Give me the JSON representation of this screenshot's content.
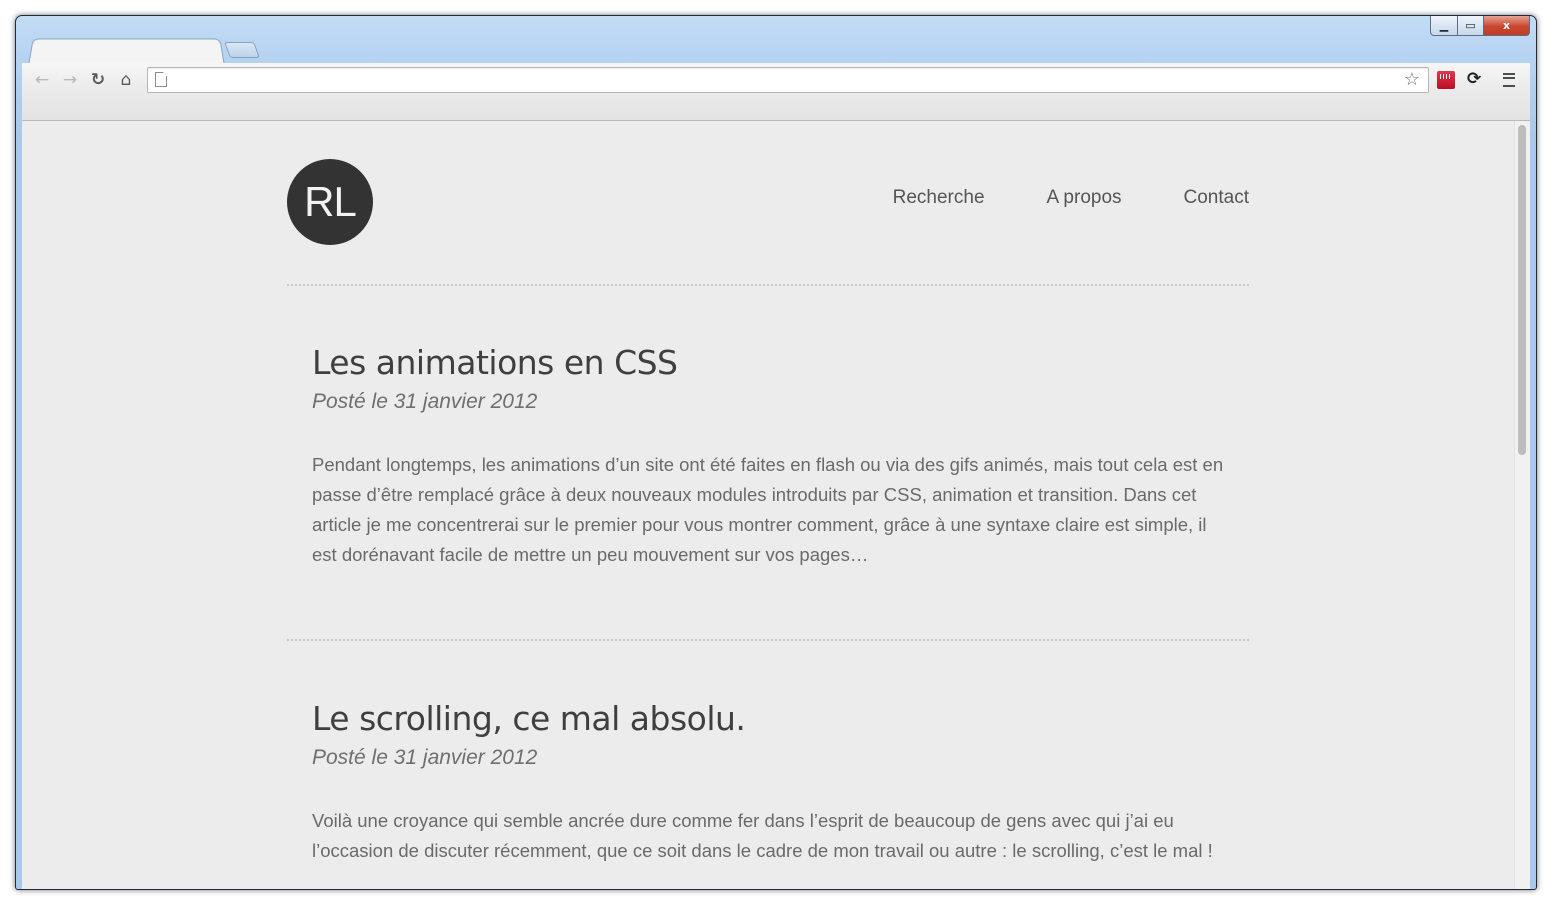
{
  "browser": {
    "window_controls": {
      "minimize": "▁",
      "maximize": "▭",
      "close": "x"
    },
    "address_bar": {
      "value": "",
      "placeholder": ""
    },
    "icons": [
      "back-icon",
      "forward-icon",
      "reload-icon",
      "home-icon",
      "page-icon",
      "star-icon",
      "extension-red-icon",
      "extension-sync-icon",
      "menu-icon"
    ]
  },
  "site": {
    "logo": "RL",
    "nav": [
      {
        "label": "Recherche"
      },
      {
        "label": "A propos"
      },
      {
        "label": "Contact"
      }
    ]
  },
  "posts": [
    {
      "title": "Les animations en CSS",
      "date": "Posté le 31 janvier 2012",
      "excerpt": "Pendant longtemps, les animations d’un site ont été faites en flash ou via des gifs animés, mais tout cela est en passe d’être remplacé grâce à deux nouveaux modules introduits par CSS, animation et transition. Dans cet article je me concentrerai sur le premier pour vous montrer comment, grâce à une syntaxe claire est simple, il est dorénavant facile de mettre un peu mouvement sur vos pages…"
    },
    {
      "title": "Le scrolling, ce mal absolu.",
      "date": "Posté le 31 janvier 2012",
      "excerpt": "Voilà une croyance qui semble ancrée dure comme fer dans l’esprit de beaucoup de gens avec qui j’ai eu l’occasion de discuter récemment, que ce soit dans le cadre de mon travail ou autre : le scrolling, c’est le mal !"
    }
  ]
}
